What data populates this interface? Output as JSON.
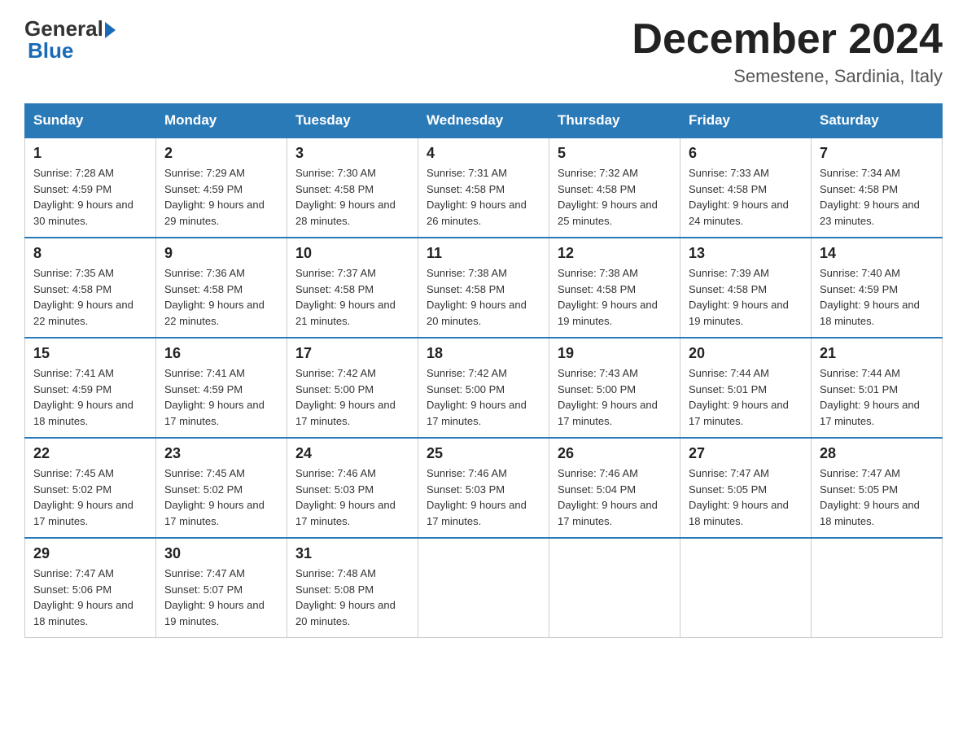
{
  "logo": {
    "general": "General",
    "arrow": "▶",
    "blue": "Blue"
  },
  "title": "December 2024",
  "subtitle": "Semestene, Sardinia, Italy",
  "days_of_week": [
    "Sunday",
    "Monday",
    "Tuesday",
    "Wednesday",
    "Thursday",
    "Friday",
    "Saturday"
  ],
  "weeks": [
    [
      {
        "day": "1",
        "sunrise": "7:28 AM",
        "sunset": "4:59 PM",
        "daylight": "9 hours and 30 minutes."
      },
      {
        "day": "2",
        "sunrise": "7:29 AM",
        "sunset": "4:59 PM",
        "daylight": "9 hours and 29 minutes."
      },
      {
        "day": "3",
        "sunrise": "7:30 AM",
        "sunset": "4:58 PM",
        "daylight": "9 hours and 28 minutes."
      },
      {
        "day": "4",
        "sunrise": "7:31 AM",
        "sunset": "4:58 PM",
        "daylight": "9 hours and 26 minutes."
      },
      {
        "day": "5",
        "sunrise": "7:32 AM",
        "sunset": "4:58 PM",
        "daylight": "9 hours and 25 minutes."
      },
      {
        "day": "6",
        "sunrise": "7:33 AM",
        "sunset": "4:58 PM",
        "daylight": "9 hours and 24 minutes."
      },
      {
        "day": "7",
        "sunrise": "7:34 AM",
        "sunset": "4:58 PM",
        "daylight": "9 hours and 23 minutes."
      }
    ],
    [
      {
        "day": "8",
        "sunrise": "7:35 AM",
        "sunset": "4:58 PM",
        "daylight": "9 hours and 22 minutes."
      },
      {
        "day": "9",
        "sunrise": "7:36 AM",
        "sunset": "4:58 PM",
        "daylight": "9 hours and 22 minutes."
      },
      {
        "day": "10",
        "sunrise": "7:37 AM",
        "sunset": "4:58 PM",
        "daylight": "9 hours and 21 minutes."
      },
      {
        "day": "11",
        "sunrise": "7:38 AM",
        "sunset": "4:58 PM",
        "daylight": "9 hours and 20 minutes."
      },
      {
        "day": "12",
        "sunrise": "7:38 AM",
        "sunset": "4:58 PM",
        "daylight": "9 hours and 19 minutes."
      },
      {
        "day": "13",
        "sunrise": "7:39 AM",
        "sunset": "4:58 PM",
        "daylight": "9 hours and 19 minutes."
      },
      {
        "day": "14",
        "sunrise": "7:40 AM",
        "sunset": "4:59 PM",
        "daylight": "9 hours and 18 minutes."
      }
    ],
    [
      {
        "day": "15",
        "sunrise": "7:41 AM",
        "sunset": "4:59 PM",
        "daylight": "9 hours and 18 minutes."
      },
      {
        "day": "16",
        "sunrise": "7:41 AM",
        "sunset": "4:59 PM",
        "daylight": "9 hours and 17 minutes."
      },
      {
        "day": "17",
        "sunrise": "7:42 AM",
        "sunset": "5:00 PM",
        "daylight": "9 hours and 17 minutes."
      },
      {
        "day": "18",
        "sunrise": "7:42 AM",
        "sunset": "5:00 PM",
        "daylight": "9 hours and 17 minutes."
      },
      {
        "day": "19",
        "sunrise": "7:43 AM",
        "sunset": "5:00 PM",
        "daylight": "9 hours and 17 minutes."
      },
      {
        "day": "20",
        "sunrise": "7:44 AM",
        "sunset": "5:01 PM",
        "daylight": "9 hours and 17 minutes."
      },
      {
        "day": "21",
        "sunrise": "7:44 AM",
        "sunset": "5:01 PM",
        "daylight": "9 hours and 17 minutes."
      }
    ],
    [
      {
        "day": "22",
        "sunrise": "7:45 AM",
        "sunset": "5:02 PM",
        "daylight": "9 hours and 17 minutes."
      },
      {
        "day": "23",
        "sunrise": "7:45 AM",
        "sunset": "5:02 PM",
        "daylight": "9 hours and 17 minutes."
      },
      {
        "day": "24",
        "sunrise": "7:46 AM",
        "sunset": "5:03 PM",
        "daylight": "9 hours and 17 minutes."
      },
      {
        "day": "25",
        "sunrise": "7:46 AM",
        "sunset": "5:03 PM",
        "daylight": "9 hours and 17 minutes."
      },
      {
        "day": "26",
        "sunrise": "7:46 AM",
        "sunset": "5:04 PM",
        "daylight": "9 hours and 17 minutes."
      },
      {
        "day": "27",
        "sunrise": "7:47 AM",
        "sunset": "5:05 PM",
        "daylight": "9 hours and 18 minutes."
      },
      {
        "day": "28",
        "sunrise": "7:47 AM",
        "sunset": "5:05 PM",
        "daylight": "9 hours and 18 minutes."
      }
    ],
    [
      {
        "day": "29",
        "sunrise": "7:47 AM",
        "sunset": "5:06 PM",
        "daylight": "9 hours and 18 minutes."
      },
      {
        "day": "30",
        "sunrise": "7:47 AM",
        "sunset": "5:07 PM",
        "daylight": "9 hours and 19 minutes."
      },
      {
        "day": "31",
        "sunrise": "7:48 AM",
        "sunset": "5:08 PM",
        "daylight": "9 hours and 20 minutes."
      },
      null,
      null,
      null,
      null
    ]
  ]
}
